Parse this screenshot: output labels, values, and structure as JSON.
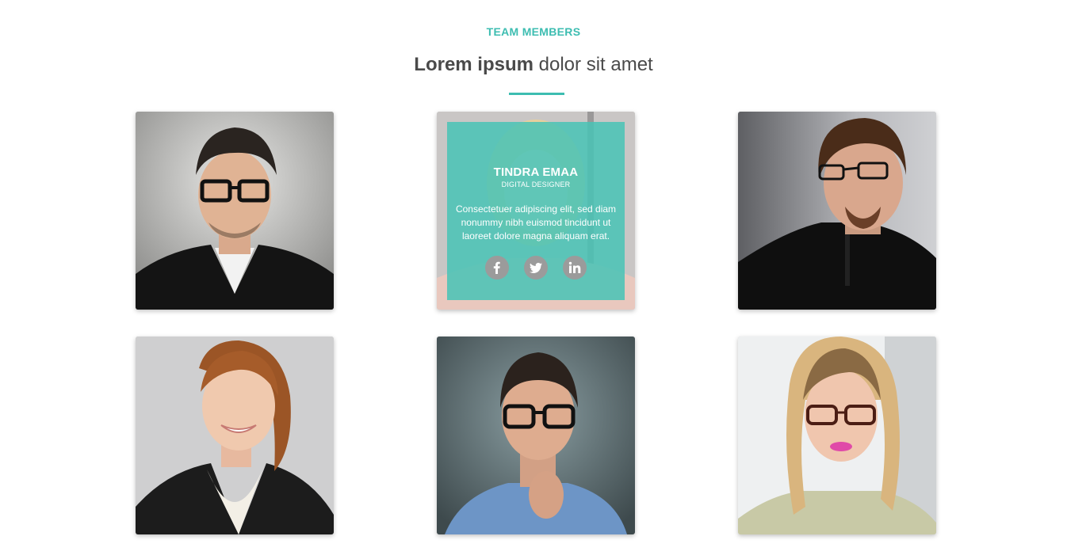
{
  "section": {
    "eyebrow": "TEAM MEMBERS",
    "heading_bold": "Lorem ipsum",
    "heading_rest": " dolor sit amet"
  },
  "accent_color": "#3dbdb1",
  "team": [
    {
      "photo": "man-glasses-black-sweater"
    },
    {
      "photo": "blonde-woman",
      "name": "TINDRA EMAA",
      "role": "DIGITAL DESIGNER",
      "bio": "Consectetuer adipiscing elit, sed diam nonummy nibh euismod tincidunt ut laoreet dolore magna aliquam erat.",
      "socials": [
        "facebook-icon",
        "twitter-icon",
        "linkedin-icon"
      ]
    },
    {
      "photo": "bearded-man-glasses"
    },
    {
      "photo": "redhead-woman-blazer"
    },
    {
      "photo": "man-thinking-glasses"
    },
    {
      "photo": "blonde-woman-glasses"
    }
  ]
}
